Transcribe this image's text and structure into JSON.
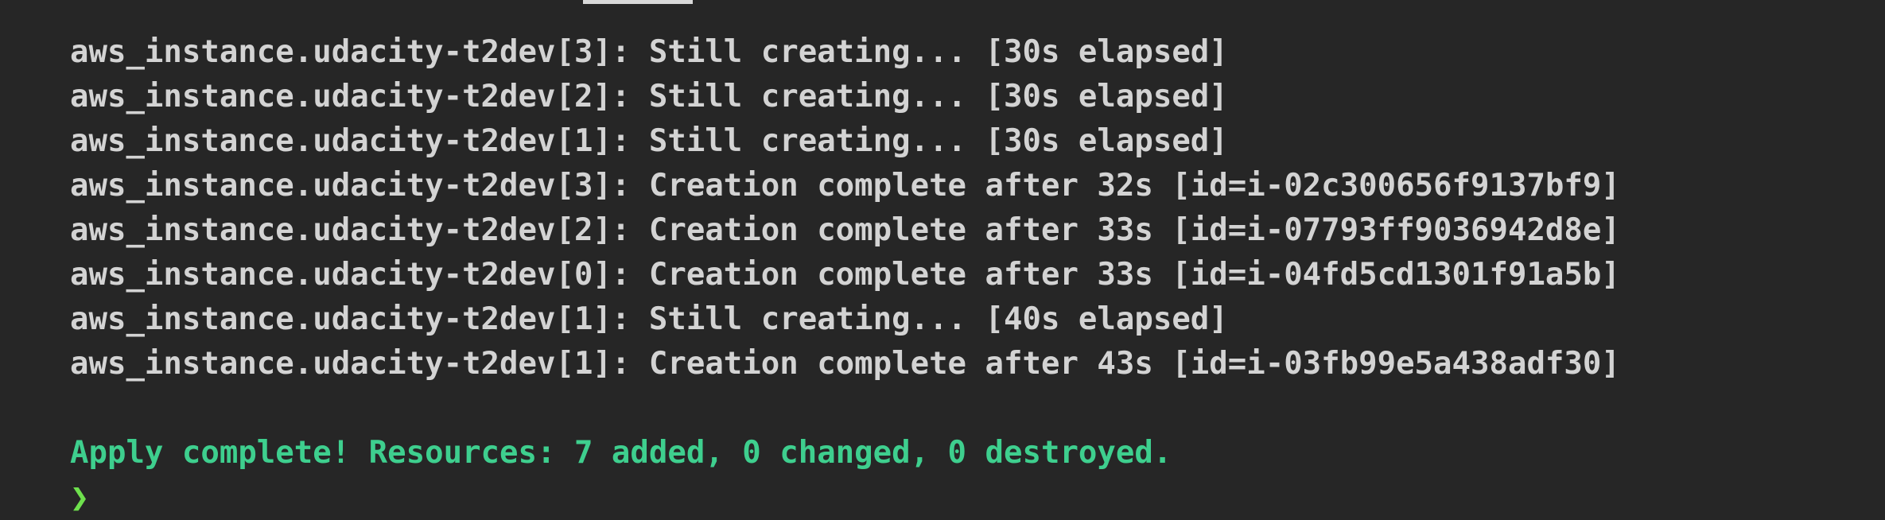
{
  "terminal": {
    "lines": [
      "aws_instance.udacity-t2dev[3]: Still creating... [30s elapsed]",
      "aws_instance.udacity-t2dev[2]: Still creating... [30s elapsed]",
      "aws_instance.udacity-t2dev[1]: Still creating... [30s elapsed]",
      "aws_instance.udacity-t2dev[3]: Creation complete after 32s [id=i-02c300656f9137bf9]",
      "aws_instance.udacity-t2dev[2]: Creation complete after 33s [id=i-07793ff9036942d8e]",
      "aws_instance.udacity-t2dev[0]: Creation complete after 33s [id=i-04fd5cd1301f91a5b]",
      "aws_instance.udacity-t2dev[1]: Still creating... [40s elapsed]",
      "aws_instance.udacity-t2dev[1]: Creation complete after 43s [id=i-03fb99e5a438adf30]"
    ],
    "summary": "Apply complete! Resources: 7 added, 0 changed, 0 destroyed.",
    "prompt_symbol": "❯"
  },
  "colors": {
    "background": "#262626",
    "text": "#d3d3d3",
    "success": "#3ecf8e",
    "prompt": "#6ee04d"
  }
}
